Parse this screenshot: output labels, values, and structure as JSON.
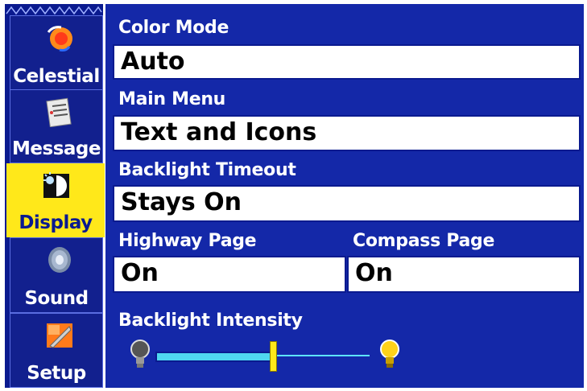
{
  "tabs": [
    {
      "label": "Celestial",
      "icon": "celestial-icon",
      "active": false
    },
    {
      "label": "Message",
      "icon": "message-icon",
      "active": false
    },
    {
      "label": "Display",
      "icon": "display-icon",
      "active": true
    },
    {
      "label": "Sound",
      "icon": "sound-icon",
      "active": false
    },
    {
      "label": "Setup",
      "icon": "setup-icon",
      "active": false
    }
  ],
  "settings": {
    "color_mode": {
      "label": "Color Mode",
      "value": "Auto"
    },
    "main_menu": {
      "label": "Main Menu",
      "value": "Text and Icons"
    },
    "backlight_timeout": {
      "label": "Backlight Timeout",
      "value": "Stays On"
    },
    "highway_page": {
      "label": "Highway Page",
      "value": "On"
    },
    "compass_page": {
      "label": "Compass Page",
      "value": "On"
    },
    "backlight_intensity": {
      "label": "Backlight Intensity",
      "level": 0.55
    }
  },
  "colors": {
    "panel": "#1428a8",
    "tab_strip": "#0a1a8f",
    "active_tab": "#ffe81a",
    "slider_track": "#4fd8f0"
  }
}
